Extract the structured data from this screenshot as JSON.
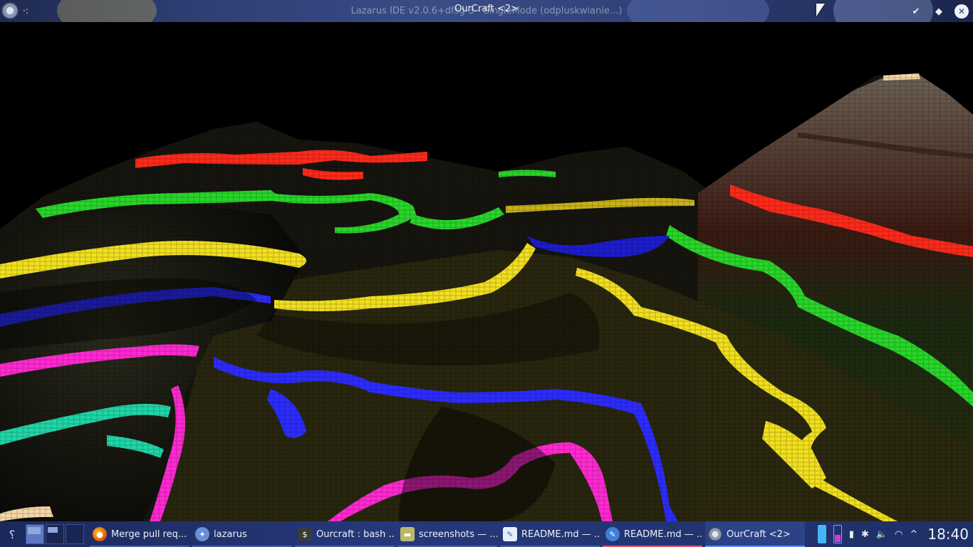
{
  "window": {
    "background_title": "Lazarus IDE v2.0.6+dfsg-3 - SingleMode (odpluskwianie...)",
    "title": "OurCraft <2>",
    "menu_glyph": "·:",
    "controls": {
      "keep_below": "✔",
      "maximize": "◆",
      "close": "✕"
    }
  },
  "taskbar": {
    "launcher_icon": "⸮",
    "tasks": [
      {
        "label": "Merge pull req...",
        "icon": "firefox-icon",
        "state": "normal",
        "color": "#e66000"
      },
      {
        "label": "lazarus",
        "icon": "lazarus-icon",
        "state": "normal",
        "color": "#6a8fd9"
      },
      {
        "label": "Ourcraft : bash ...",
        "icon": "terminal-icon",
        "state": "normal",
        "color": "#3b3b3b"
      },
      {
        "label": "screenshots — ...",
        "icon": "folder-icon",
        "state": "normal",
        "color": "#b9b96a"
      },
      {
        "label": "README.md — ...",
        "icon": "document-icon",
        "state": "normal",
        "color": "#e8eef8"
      },
      {
        "label": "README.md — ...",
        "icon": "kate-icon",
        "state": "attention",
        "color": "#3e7fd8"
      },
      {
        "label": "OurCraft <2>",
        "icon": "ourcraft-icon",
        "state": "active",
        "color": "#9aa5bd"
      }
    ],
    "tray": {
      "clock": "18:40",
      "icons": [
        "battery-icon",
        "bluetooth-icon",
        "volume-icon",
        "wifi-icon",
        "expand-tray-icon"
      ],
      "glyphs": [
        "▮",
        "✱",
        "🔈",
        "◠",
        "^"
      ]
    }
  },
  "colors": {
    "red": "#ff2a1a",
    "green": "#29d62a",
    "yellow": "#f2e01f",
    "blue": "#2c2cff",
    "magenta": "#ff2ad2",
    "teal": "#1fd6a8",
    "tan": "#f6d7a8"
  }
}
